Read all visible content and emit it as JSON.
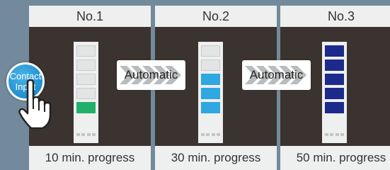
{
  "panels": [
    {
      "title": "No.1",
      "progress_label": "10 min. progress",
      "lit_segments": 1,
      "lit_color": "#21b06c"
    },
    {
      "title": "No.2",
      "progress_label": "30 min. progress",
      "lit_segments": 3,
      "lit_color": "#2fa7e0"
    },
    {
      "title": "No.3",
      "progress_label": "50 min. progress",
      "lit_segments": 5,
      "lit_color": "#1c2a8c"
    }
  ],
  "segment_count": 5,
  "unlit_color": "#e3e4e4",
  "arrows": [
    {
      "label": "Automatic"
    },
    {
      "label": "Automatic"
    }
  ],
  "contact_input": {
    "line1": "Contact",
    "line2": "Input"
  },
  "icons": {
    "pointer": "pointing-hand-icon",
    "arrows": "chevron-arrows-icon"
  }
}
